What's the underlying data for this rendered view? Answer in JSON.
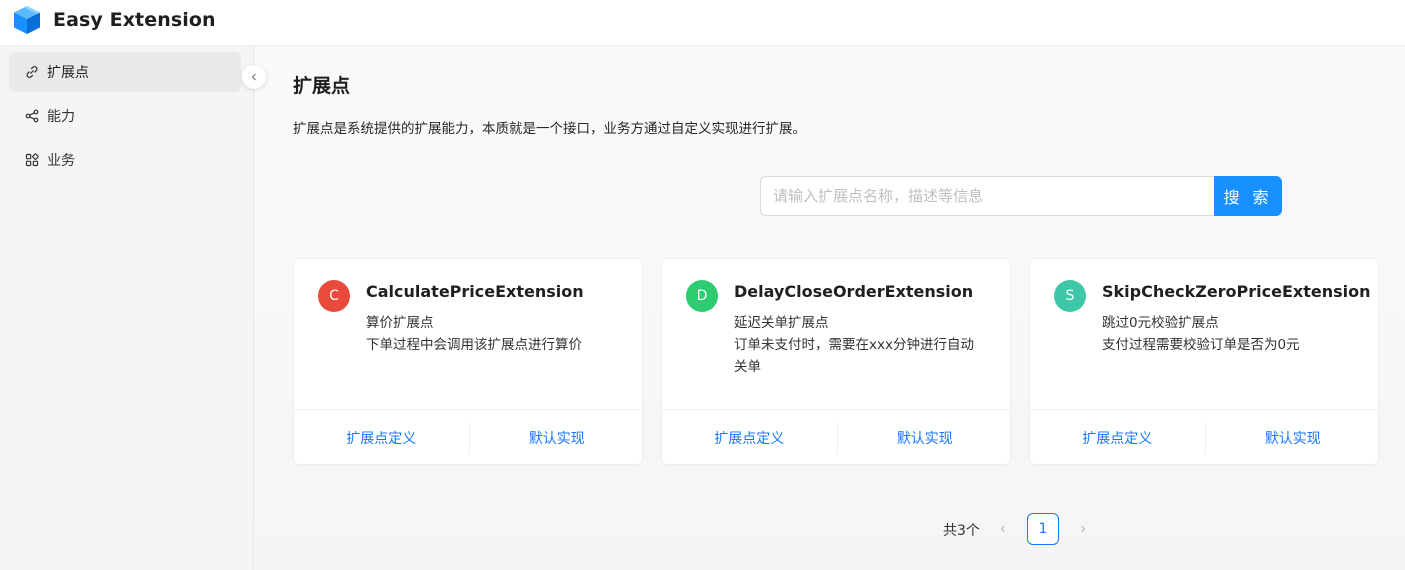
{
  "app": {
    "title": "Easy Extension",
    "logo_icon": "cube-icon",
    "brand_color": "#1890ff"
  },
  "sidebar": {
    "items": [
      {
        "label": "扩展点",
        "icon": "link-icon",
        "active": true
      },
      {
        "label": "能力",
        "icon": "share-icon",
        "active": false
      },
      {
        "label": "业务",
        "icon": "grid-icon",
        "active": false
      }
    ]
  },
  "page": {
    "title": "扩展点",
    "description": "扩展点是系统提供的扩展能力，本质就是一个接口，业务方通过自定义实现进行扩展。"
  },
  "search": {
    "placeholder": "请输入扩展点名称，描述等信息",
    "value": "",
    "button_label": "搜 索"
  },
  "cards": [
    {
      "avatar_letter": "C",
      "avatar_color": "#e84a3c",
      "title": "CalculatePriceExtension",
      "desc_line1": "算价扩展点",
      "desc_line2": "下单过程中会调用该扩展点进行算价",
      "action_definition": "扩展点定义",
      "action_default": "默认实现"
    },
    {
      "avatar_letter": "D",
      "avatar_color": "#2ecc71",
      "title": "DelayCloseOrderExtension",
      "desc_line1": "延迟关单扩展点",
      "desc_line2": "订单未支付时，需要在xxx分钟进行自动关单",
      "action_definition": "扩展点定义",
      "action_default": "默认实现"
    },
    {
      "avatar_letter": "S",
      "avatar_color": "#3fc8a8",
      "title": "SkipCheckZeroPriceExtension",
      "desc_line1": "跳过0元校验扩展点",
      "desc_line2": "支付过程需要校验订单是否为0元",
      "action_definition": "扩展点定义",
      "action_default": "默认实现"
    }
  ],
  "pagination": {
    "total_text": "共3个",
    "current_page": "1"
  }
}
